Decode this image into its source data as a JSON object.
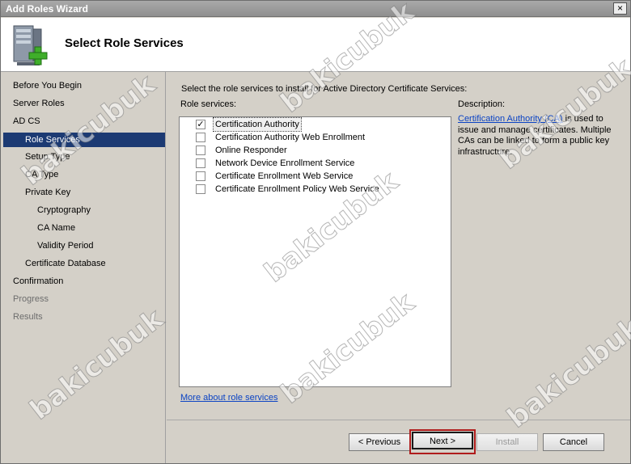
{
  "window": {
    "title": "Add Roles Wizard",
    "close_glyph": "×"
  },
  "header": {
    "title": "Select Role Services",
    "icon": "server-add-icon"
  },
  "nav": {
    "items": [
      {
        "label": "Before You Begin",
        "state": "normal"
      },
      {
        "label": "Server Roles",
        "state": "normal"
      },
      {
        "label": "AD CS",
        "state": "normal"
      },
      {
        "label": "Role Services",
        "state": "selected"
      },
      {
        "label": "Setup Type",
        "state": "normal"
      },
      {
        "label": "CA Type",
        "state": "normal"
      },
      {
        "label": "Private Key",
        "state": "normal"
      },
      {
        "label": "Cryptography",
        "state": "normal"
      },
      {
        "label": "CA Name",
        "state": "normal"
      },
      {
        "label": "Validity Period",
        "state": "normal"
      },
      {
        "label": "Certificate Database",
        "state": "normal"
      },
      {
        "label": "Confirmation",
        "state": "normal"
      },
      {
        "label": "Progress",
        "state": "disabled"
      },
      {
        "label": "Results",
        "state": "disabled"
      }
    ]
  },
  "main": {
    "intro": "Select the role services to install for Active Directory Certificate Services:",
    "role_services_label": "Role services:",
    "role_services": [
      {
        "label": "Certification Authority",
        "checked": true,
        "mark": "✓"
      },
      {
        "label": "Certification Authority Web Enrollment",
        "checked": false,
        "mark": ""
      },
      {
        "label": "Online Responder",
        "checked": false,
        "mark": ""
      },
      {
        "label": "Network Device Enrollment Service",
        "checked": false,
        "mark": ""
      },
      {
        "label": "Certificate Enrollment Web Service",
        "checked": false,
        "mark": ""
      },
      {
        "label": "Certificate Enrollment Policy Web Service",
        "checked": false,
        "mark": ""
      }
    ],
    "description_label": "Description:",
    "description_link": "Certification Authority (CA)",
    "description_text": " is used to issue and manage certificates. Multiple CAs can be linked to form a public key infrastructure.",
    "more_link": "More about role services"
  },
  "footer": {
    "previous": "< Previous",
    "next": "Next >",
    "install": "Install",
    "cancel": "Cancel"
  },
  "watermark": "bakicubuk",
  "colors": {
    "selection": "#1c3a73",
    "link": "#0b43c4",
    "highlight": "#b01c1c",
    "dialog": "#d4d0c8"
  }
}
